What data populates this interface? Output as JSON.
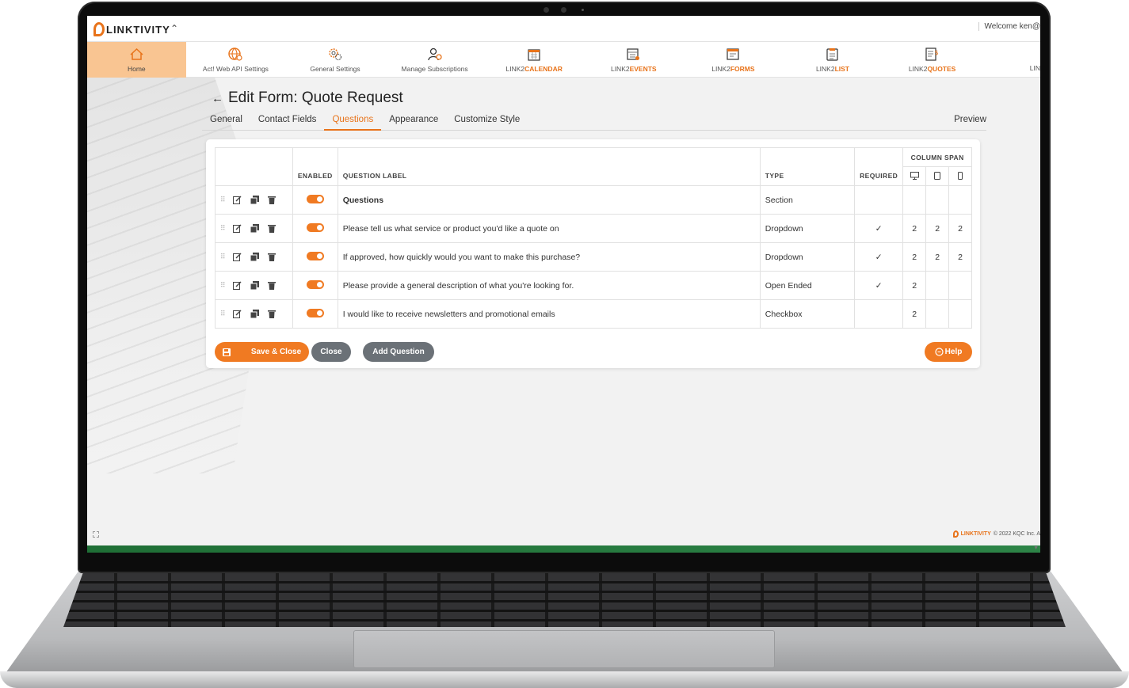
{
  "topbar": {
    "welcome": "Welcome ken@",
    "logo_text": "LINKTIVITY"
  },
  "nav": [
    {
      "label": "Home",
      "icon": "home-icon",
      "active": true
    },
    {
      "label": "Act! Web API Settings",
      "icon": "globe-gear-icon"
    },
    {
      "label": "General Settings",
      "icon": "gears-icon"
    },
    {
      "label": "Manage Subscriptions",
      "icon": "user-gear-icon"
    },
    {
      "prefix": "LINK2",
      "suffix": "CALENDAR",
      "icon": "calendar-icon"
    },
    {
      "prefix": "LINK2",
      "suffix": "EVENTS",
      "icon": "events-calendar-icon"
    },
    {
      "prefix": "LINK2",
      "suffix": "FORMS",
      "icon": "form-icon"
    },
    {
      "prefix": "LINK2",
      "suffix": "LIST",
      "icon": "clipboard-list-icon"
    },
    {
      "prefix": "LINK2",
      "suffix": "QUOTES",
      "icon": "quote-document-icon"
    },
    {
      "label": "LIN",
      "icon": ""
    }
  ],
  "page": {
    "title": "Edit Form: Quote Request"
  },
  "tabs": [
    "General",
    "Contact Fields",
    "Questions",
    "Appearance",
    "Customize Style"
  ],
  "preview_label": "Preview",
  "table": {
    "headers": {
      "enabled": "ENABLED",
      "question_label": "QUESTION LABEL",
      "type": "TYPE",
      "required": "REQUIRED",
      "column_span": "COLUMN SPAN"
    },
    "rows": [
      {
        "label": "Questions",
        "type": "Section",
        "required": "",
        "desktop": "",
        "tablet": "",
        "mobile": "",
        "bold": true
      },
      {
        "label": "Please tell us what service or product you'd like a quote on",
        "type": "Dropdown",
        "required": "✓",
        "desktop": "2",
        "tablet": "2",
        "mobile": "2"
      },
      {
        "label": "If approved, how quickly would you want to make this purchase?",
        "type": "Dropdown",
        "required": "✓",
        "desktop": "2",
        "tablet": "2",
        "mobile": "2"
      },
      {
        "label": "Please provide a general description of what you're looking for.",
        "type": "Open Ended",
        "required": "✓",
        "desktop": "2",
        "tablet": "",
        "mobile": ""
      },
      {
        "label": "I would like to receive newsletters and promotional emails",
        "type": "Checkbox",
        "required": "",
        "desktop": "2",
        "tablet": "",
        "mobile": ""
      }
    ]
  },
  "buttons": {
    "save": "Save & Close",
    "close": "Close",
    "add": "Add Question",
    "help": "Help"
  },
  "footer": {
    "logo_text": "LINKTIVITY",
    "copyright": "© 2022 KQC Inc. A"
  },
  "colors": {
    "accent": "#f07a22",
    "nav_active": "#f9c592",
    "button_gray": "#6b7177",
    "green_bar": "#1f6f36"
  }
}
